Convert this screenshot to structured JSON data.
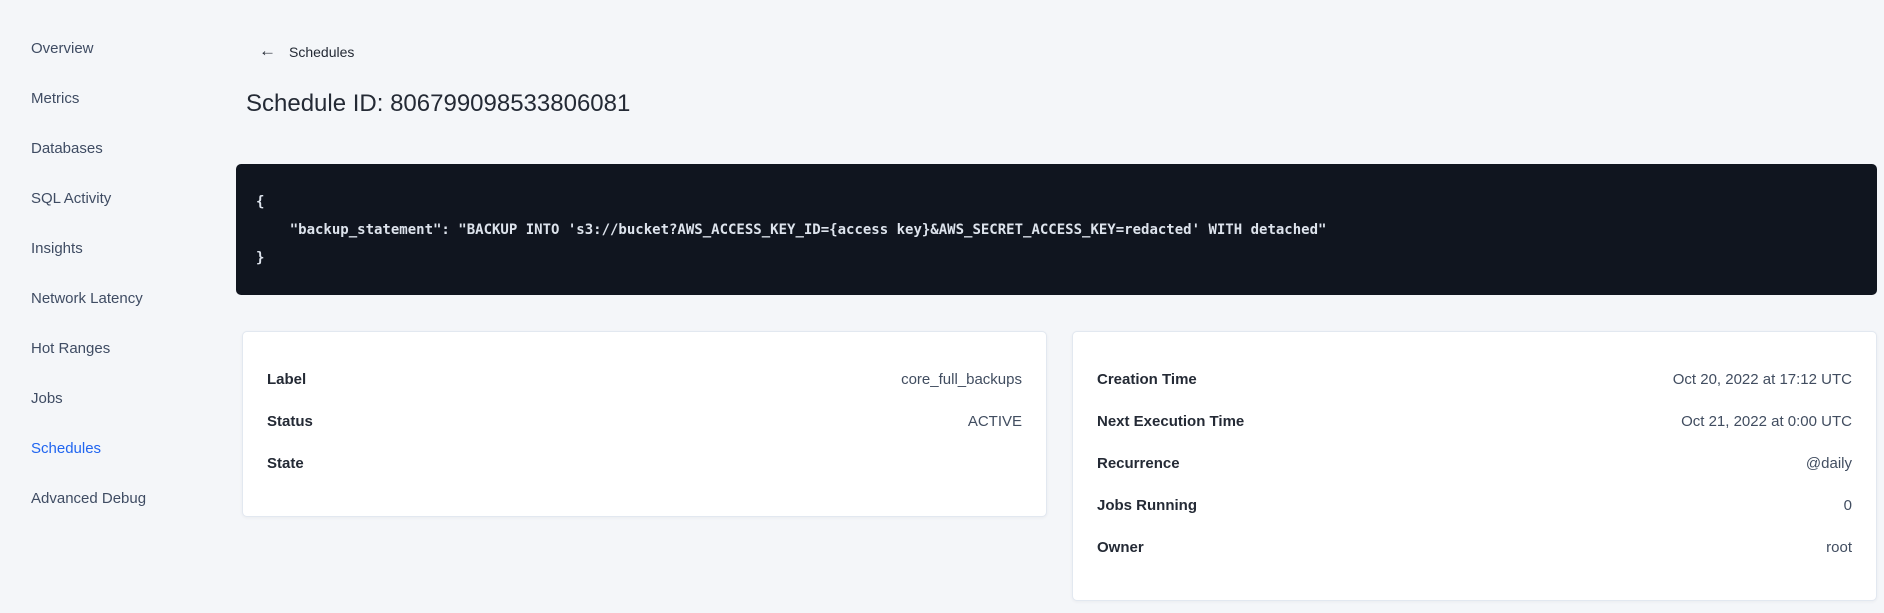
{
  "sidebar": {
    "items": [
      {
        "label": "Overview",
        "active": false
      },
      {
        "label": "Metrics",
        "active": false
      },
      {
        "label": "Databases",
        "active": false
      },
      {
        "label": "SQL Activity",
        "active": false
      },
      {
        "label": "Insights",
        "active": false
      },
      {
        "label": "Network Latency",
        "active": false
      },
      {
        "label": "Hot Ranges",
        "active": false
      },
      {
        "label": "Jobs",
        "active": false
      },
      {
        "label": "Schedules",
        "active": true
      },
      {
        "label": "Advanced Debug",
        "active": false
      }
    ]
  },
  "header": {
    "back_icon": "←",
    "back_label": "Schedules",
    "title": "Schedule ID: 806799098533806081"
  },
  "code_block": {
    "lines": [
      "{",
      "    \"backup_statement\": \"BACKUP INTO 's3://bucket?AWS_ACCESS_KEY_ID={access key}&AWS_SECRET_ACCESS_KEY=redacted' WITH detached\"",
      "}"
    ]
  },
  "details_left": {
    "rows": [
      {
        "label": "Label",
        "value": "core_full_backups"
      },
      {
        "label": "Status",
        "value": "ACTIVE"
      },
      {
        "label": "State",
        "value": ""
      }
    ]
  },
  "details_right": {
    "rows": [
      {
        "label": "Creation Time",
        "value": "Oct 20, 2022 at 17:12 UTC"
      },
      {
        "label": "Next Execution Time",
        "value": "Oct 21, 2022 at 0:00 UTC"
      },
      {
        "label": "Recurrence",
        "value": "@daily"
      },
      {
        "label": "Jobs Running",
        "value": "0"
      },
      {
        "label": "Owner",
        "value": "root"
      }
    ]
  },
  "colors": {
    "accent_blue": "#2065f0",
    "page_background": "#f4f6f9",
    "code_background": "#10151f",
    "code_text": "#dde3ec",
    "card_background": "#ffffff",
    "card_border": "#e2e8f0",
    "text_primary": "#242a35",
    "text_secondary": "#414d60"
  }
}
